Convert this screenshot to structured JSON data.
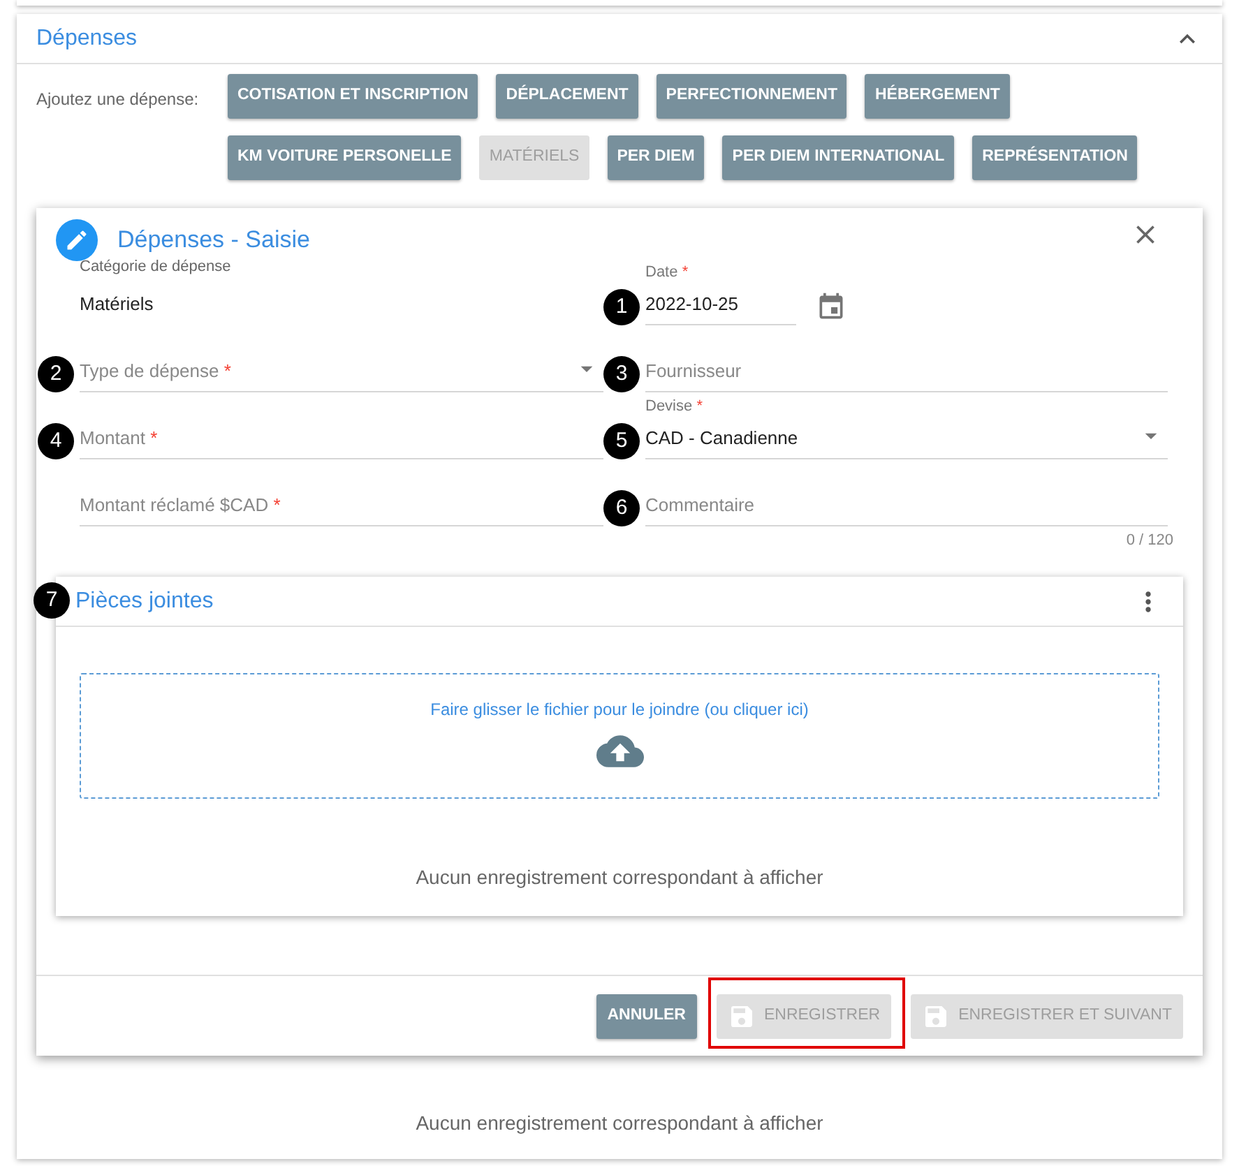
{
  "section": {
    "title": "Dépenses",
    "expanded": true
  },
  "add_label": "Ajoutez une dépense:",
  "categories": [
    {
      "label": "COTISATION ET INSCRIPTION",
      "disabled": false
    },
    {
      "label": "DÉPLACEMENT",
      "disabled": false
    },
    {
      "label": "PERFECTIONNEMENT",
      "disabled": false
    },
    {
      "label": "HÉBERGEMENT",
      "disabled": false
    },
    {
      "label": "KM VOITURE PERSONELLE",
      "disabled": false
    },
    {
      "label": "MATÉRIELS",
      "disabled": true
    },
    {
      "label": "PER DIEM",
      "disabled": false
    },
    {
      "label": "PER DIEM INTERNATIONAL",
      "disabled": false
    },
    {
      "label": "REPRÉSENTATION",
      "disabled": false
    }
  ],
  "dialog": {
    "title": "Dépenses - Saisie",
    "rows": [
      [
        {
          "kind": "display",
          "label": "Catégorie de dépense",
          "value": "Matériels"
        },
        {
          "kind": "date",
          "label": "Date",
          "required_mark": "*",
          "value": "2022-10-25",
          "marker": "1"
        }
      ],
      [
        {
          "kind": "select",
          "label": "Type de dépense",
          "required_mark": "*",
          "marker": "2"
        },
        {
          "kind": "text",
          "label": "Fournisseur",
          "marker": "3"
        }
      ],
      [
        {
          "kind": "text",
          "label": "Montant",
          "required_mark": "*",
          "marker": "4"
        },
        {
          "kind": "select",
          "label": "Devise",
          "required_mark": "*",
          "value": "CAD - Canadienne",
          "marker": "5"
        }
      ],
      [
        {
          "kind": "text",
          "label": "Montant réclamé $CAD",
          "required_mark": "*"
        },
        {
          "kind": "text",
          "label": "Commentaire",
          "marker": "6",
          "counter": "0 / 120"
        }
      ]
    ],
    "attachments": {
      "title": "Pièces jointes",
      "marker": "7",
      "dropzone": "Faire glisser le fichier pour le joindre (ou cliquer ici)",
      "empty": "Aucun enregistrement correspondant à afficher"
    },
    "buttons": [
      {
        "label": "ANNULER",
        "kind": "plain",
        "disabled": false,
        "highlighted": false
      },
      {
        "label": "ENREGISTRER",
        "kind": "save",
        "disabled": true,
        "highlighted": true
      },
      {
        "label": "ENREGISTRER ET SUIVANT",
        "kind": "save",
        "disabled": true,
        "highlighted": false
      }
    ]
  },
  "empty": "Aucun enregistrement correspondant à afficher"
}
